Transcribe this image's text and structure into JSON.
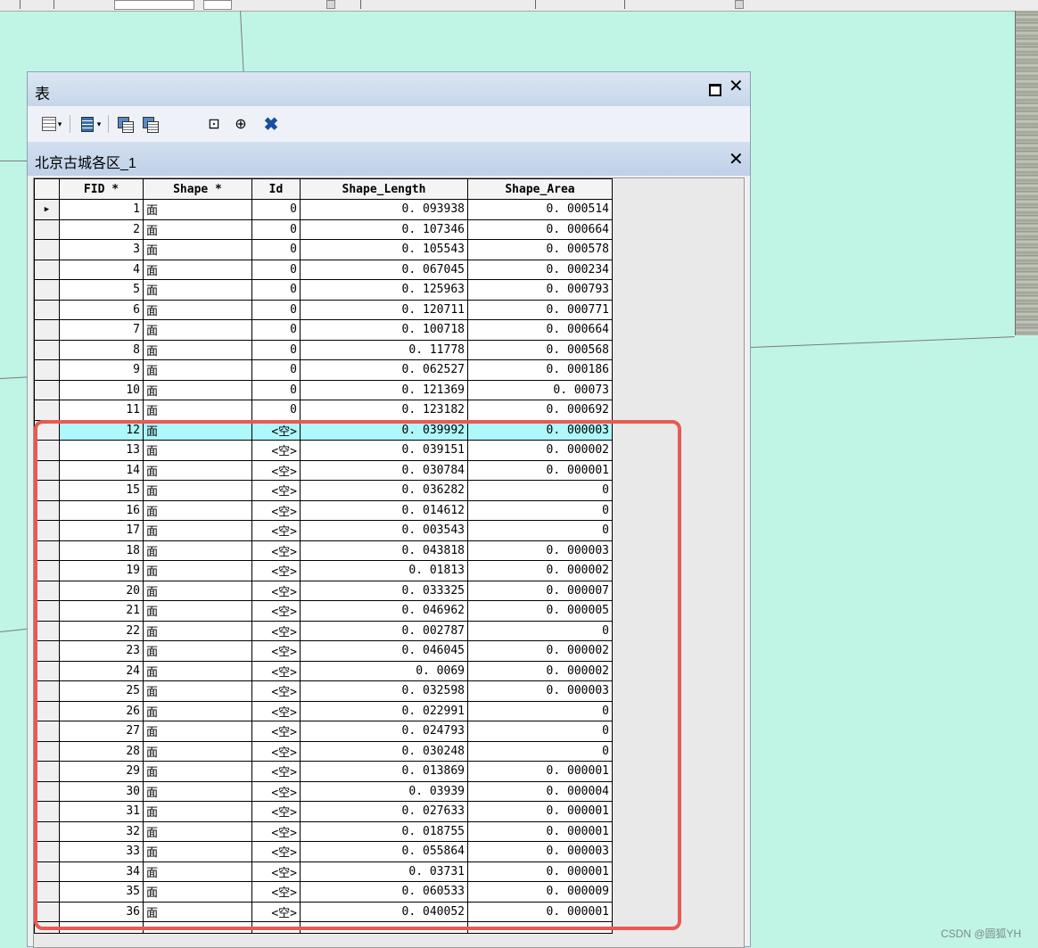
{
  "window": {
    "title": "表",
    "table_name": "北京古城各区_1"
  },
  "columns": [
    "FID *",
    "Shape *",
    "Id",
    "Shape_Length",
    "Shape_Area"
  ],
  "rows": [
    [
      "1",
      "面",
      "0",
      "0. 093938",
      "0. 000514"
    ],
    [
      "2",
      "面",
      "0",
      "0. 107346",
      "0. 000664"
    ],
    [
      "3",
      "面",
      "0",
      "0. 105543",
      "0. 000578"
    ],
    [
      "4",
      "面",
      "0",
      "0. 067045",
      "0. 000234"
    ],
    [
      "5",
      "面",
      "0",
      "0. 125963",
      "0. 000793"
    ],
    [
      "6",
      "面",
      "0",
      "0. 120711",
      "0. 000771"
    ],
    [
      "7",
      "面",
      "0",
      "0. 100718",
      "0. 000664"
    ],
    [
      "8",
      "面",
      "0",
      "0. 11778",
      "0. 000568"
    ],
    [
      "9",
      "面",
      "0",
      "0. 062527",
      "0. 000186"
    ],
    [
      "10",
      "面",
      "0",
      "0. 121369",
      "0. 00073"
    ],
    [
      "11",
      "面",
      "0",
      "0. 123182",
      "0. 000692"
    ],
    [
      "12",
      "面",
      "<空>",
      "0. 039992",
      "0. 000003"
    ],
    [
      "13",
      "面",
      "<空>",
      "0. 039151",
      "0. 000002"
    ],
    [
      "14",
      "面",
      "<空>",
      "0. 030784",
      "0. 000001"
    ],
    [
      "15",
      "面",
      "<空>",
      "0. 036282",
      "0"
    ],
    [
      "16",
      "面",
      "<空>",
      "0. 014612",
      "0"
    ],
    [
      "17",
      "面",
      "<空>",
      "0. 003543",
      "0"
    ],
    [
      "18",
      "面",
      "<空>",
      "0. 043818",
      "0. 000003"
    ],
    [
      "19",
      "面",
      "<空>",
      "0. 01813",
      "0. 000002"
    ],
    [
      "20",
      "面",
      "<空>",
      "0. 033325",
      "0. 000007"
    ],
    [
      "21",
      "面",
      "<空>",
      "0. 046962",
      "0. 000005"
    ],
    [
      "22",
      "面",
      "<空>",
      "0. 002787",
      "0"
    ],
    [
      "23",
      "面",
      "<空>",
      "0. 046045",
      "0. 000002"
    ],
    [
      "24",
      "面",
      "<空>",
      "0. 0069",
      "0. 000002"
    ],
    [
      "25",
      "面",
      "<空>",
      "0. 032598",
      "0. 000003"
    ],
    [
      "26",
      "面",
      "<空>",
      "0. 022991",
      "0"
    ],
    [
      "27",
      "面",
      "<空>",
      "0. 024793",
      "0"
    ],
    [
      "28",
      "面",
      "<空>",
      "0. 030248",
      "0"
    ],
    [
      "29",
      "面",
      "<空>",
      "0. 013869",
      "0. 000001"
    ],
    [
      "30",
      "面",
      "<空>",
      "0. 03939",
      "0. 000004"
    ],
    [
      "31",
      "面",
      "<空>",
      "0. 027633",
      "0. 000001"
    ],
    [
      "32",
      "面",
      "<空>",
      "0. 018755",
      "0. 000001"
    ],
    [
      "33",
      "面",
      "<空>",
      "0. 055864",
      "0. 000003"
    ],
    [
      "34",
      "面",
      "<空>",
      "0. 03731",
      "0. 000001"
    ],
    [
      "35",
      "面",
      "<空>",
      "0. 060533",
      "0. 000009"
    ],
    [
      "36",
      "面",
      "<空>",
      "0. 040052",
      "0. 000001"
    ]
  ],
  "current_row_fid": "1",
  "highlighted_row_fid": "12",
  "colors": {
    "highlight": "#aef8fb",
    "annotation": "#e85a53",
    "map_background": "#c0f5e6"
  },
  "icons": [
    "table-options-icon",
    "related-tables-icon",
    "select-by-attributes-icon",
    "switch-selection-icon",
    "clear-selection-icon",
    "zoom-to-selected-icon",
    "delete-selected-icon"
  ],
  "watermark": "CSDN @圆狐YH"
}
